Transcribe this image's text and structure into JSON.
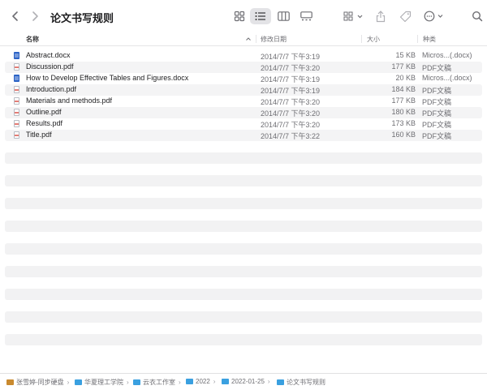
{
  "window": {
    "title": "论文书写规则"
  },
  "toolbar": {
    "back_icon": "chevron-left-icon",
    "forward_icon": "chevron-right-icon",
    "views": [
      "icons-view-icon",
      "list-view-icon",
      "columns-view-icon",
      "gallery-view-icon"
    ],
    "active_view": "list",
    "group_icon": "group-by-icon",
    "share_icon": "share-icon",
    "tag_icon": "tag-icon",
    "more_icon": "ellipsis-circle-icon",
    "search_icon": "search-icon"
  },
  "columns": {
    "name": "名称",
    "date": "修改日期",
    "size": "大小",
    "kind": "种类"
  },
  "files": [
    {
      "name": "Abstract.docx",
      "date": "2014/7/7 下午3:19",
      "size": "15 KB",
      "kind": "Micros...(.docx)",
      "type": "docx"
    },
    {
      "name": "Discussion.pdf",
      "date": "2014/7/7 下午3:20",
      "size": "177 KB",
      "kind": "PDF文稿",
      "type": "pdf"
    },
    {
      "name": "How to Develop Effective Tables and Figures.docx",
      "date": "2014/7/7 下午3:19",
      "size": "20 KB",
      "kind": "Micros...(.docx)",
      "type": "docx"
    },
    {
      "name": "Introduction.pdf",
      "date": "2014/7/7 下午3:19",
      "size": "184 KB",
      "kind": "PDF文稿",
      "type": "pdf"
    },
    {
      "name": "Materials and methods.pdf",
      "date": "2014/7/7 下午3:20",
      "size": "177 KB",
      "kind": "PDF文稿",
      "type": "pdf"
    },
    {
      "name": "Outline.pdf",
      "date": "2014/7/7 下午3:20",
      "size": "180 KB",
      "kind": "PDF文稿",
      "type": "pdf"
    },
    {
      "name": "Results.pdf",
      "date": "2014/7/7 下午3:20",
      "size": "173 KB",
      "kind": "PDF文稿",
      "type": "pdf"
    },
    {
      "name": "Title.pdf",
      "date": "2014/7/7 下午3:22",
      "size": "160 KB",
      "kind": "PDF文稿",
      "type": "pdf"
    }
  ],
  "pathbar": [
    {
      "label": "张雪婷-同步硬盘",
      "icon": "disk-icon"
    },
    {
      "label": "华夏理工学院",
      "icon": "folder-icon"
    },
    {
      "label": "云衣工作室",
      "icon": "folder-icon"
    },
    {
      "label": "2022",
      "icon": "folder-icon"
    },
    {
      "label": "2022-01-25",
      "icon": "folder-icon"
    },
    {
      "label": "论文书写规则",
      "icon": "folder-icon"
    }
  ],
  "colors": {
    "accent": "#3aa0e0",
    "docx": "#2b63c6",
    "stripe": "#f2f2f3"
  }
}
